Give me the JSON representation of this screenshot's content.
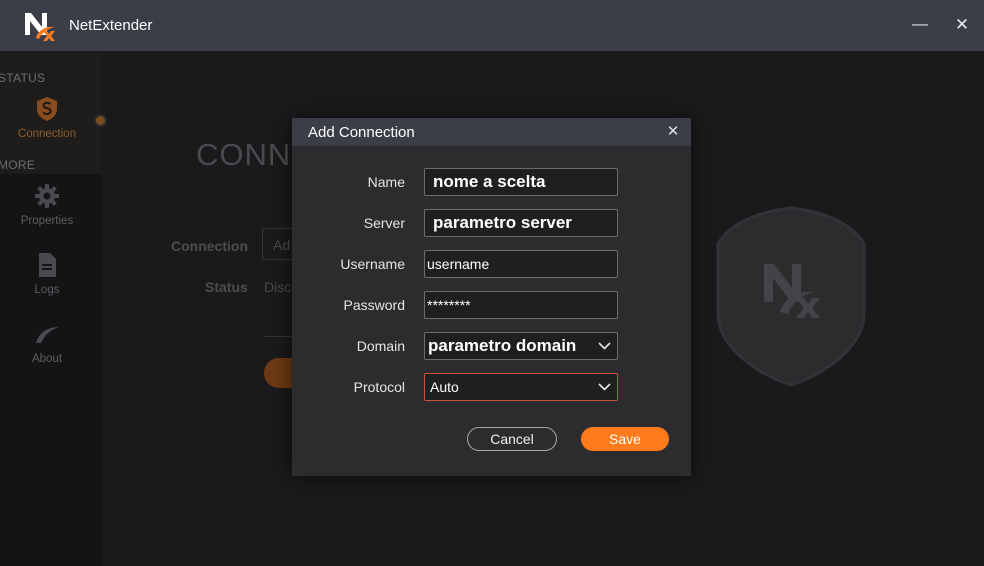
{
  "app": {
    "title": "NetExtender",
    "minimize_glyph": "—",
    "close_glyph": "✕"
  },
  "sidebar": {
    "section_status": "STATUS",
    "section_more": "MORE",
    "items": [
      {
        "label": "Connection",
        "icon": "shield-s-icon"
      },
      {
        "label": "Properties",
        "icon": "gear-icon"
      },
      {
        "label": "Logs",
        "icon": "document-icon"
      },
      {
        "label": "About",
        "icon": "swoosh-icon"
      }
    ]
  },
  "background": {
    "heading": "CONN",
    "connection_label": "Connection",
    "connection_value": "Ad",
    "status_label": "Status",
    "status_value": "Disc"
  },
  "dialog": {
    "title": "Add Connection",
    "close_glyph": "✕",
    "fields": {
      "name": {
        "label": "Name",
        "value": "nome a scelta"
      },
      "server": {
        "label": "Server",
        "value": "parametro server"
      },
      "username": {
        "label": "Username",
        "value": "username"
      },
      "password": {
        "label": "Password",
        "value": "********"
      },
      "domain": {
        "label": "Domain",
        "value": "parametro domain"
      },
      "protocol": {
        "label": "Protocol",
        "value": "Auto"
      }
    },
    "cancel_label": "Cancel",
    "save_label": "Save"
  },
  "colors": {
    "accent": "#ff7a1a",
    "titlebar": "#3b3d47",
    "dialog_bg": "#2c2c2f",
    "focus_border": "#c8553a"
  }
}
